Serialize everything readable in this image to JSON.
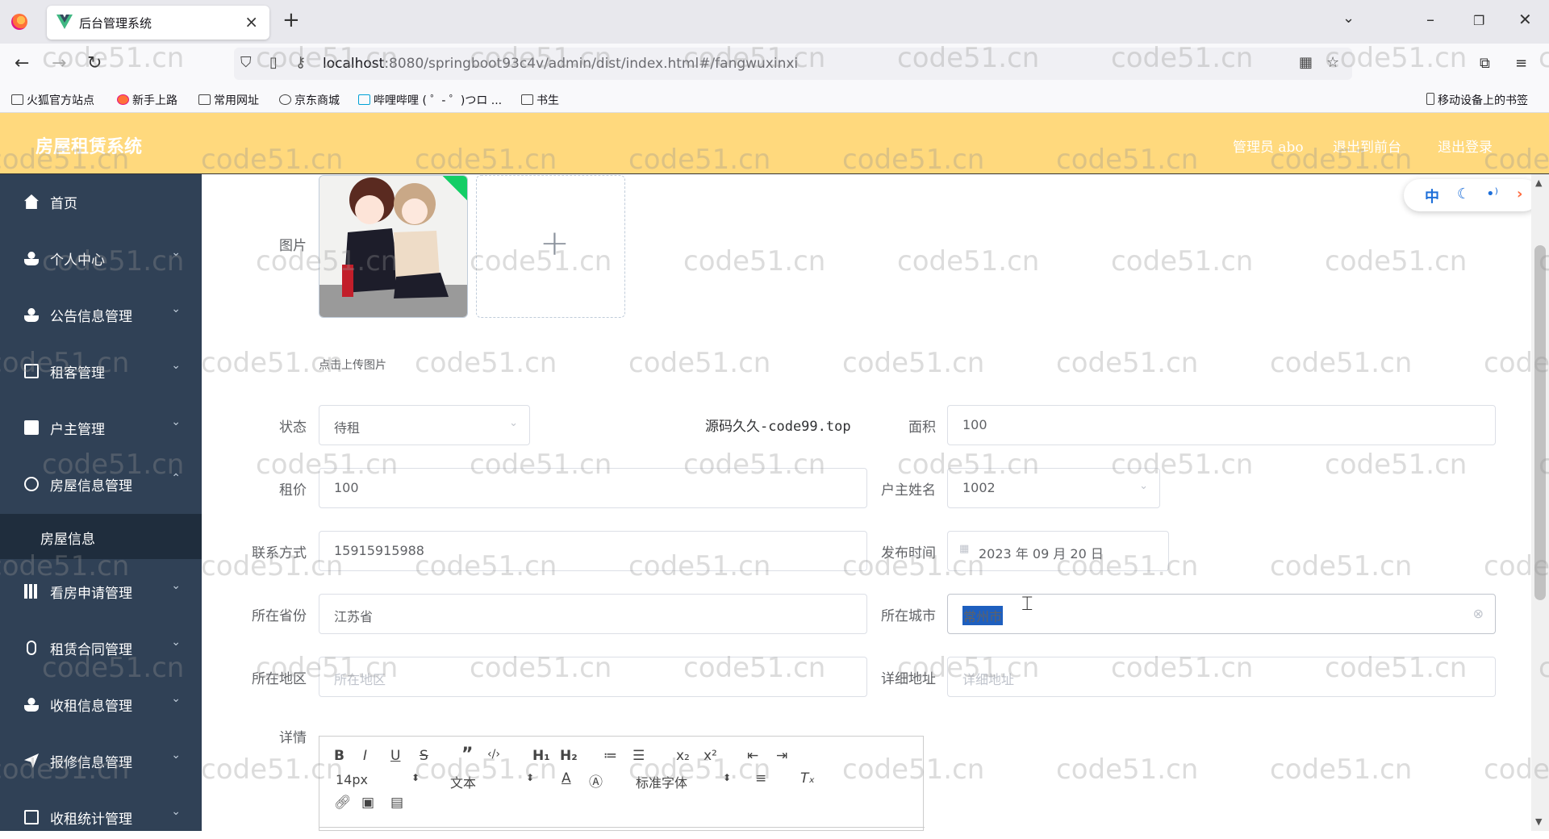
{
  "browser": {
    "tab_title": "后台管理系统",
    "url_host": "localhost",
    "url_rest": ":8080/springboot93c4v/admin/dist/index.html#/fangwuxinxi",
    "bookmarks": [
      "火狐官方站点",
      "新手上路",
      "常用网址",
      "京东商城",
      "哔哩哔哩 ( ゜- ゜)つロ ...",
      "书生"
    ],
    "mobile_bookmarks": "移动设备上的书签"
  },
  "header": {
    "app_title": "房屋租赁系统",
    "user_label": "管理员 abo",
    "front_label": "退出到前台",
    "logout_label": "退出登录"
  },
  "sidebar": {
    "items": [
      {
        "label": "首页"
      },
      {
        "label": "个人中心"
      },
      {
        "label": "公告信息管理"
      },
      {
        "label": "租客管理"
      },
      {
        "label": "户主管理"
      },
      {
        "label": "房屋信息管理"
      },
      {
        "label": "看房申请管理"
      },
      {
        "label": "租赁合同管理"
      },
      {
        "label": "收租信息管理"
      },
      {
        "label": "报修信息管理"
      },
      {
        "label": "收租统计管理"
      }
    ],
    "sub_item": "房屋信息"
  },
  "form": {
    "image_label": "图片",
    "upload_hint": "点击上传图片",
    "status_label": "状态",
    "status_value": "待租",
    "area_label": "面积",
    "area_value": "100",
    "rent_label": "租价",
    "rent_value": "100",
    "owner_label": "户主姓名",
    "owner_value": "1002",
    "contact_label": "联系方式",
    "contact_value": "15915915988",
    "publish_label": "发布时间",
    "publish_value": "2023 年 09 月 20 日",
    "province_label": "所在省份",
    "province_value": "江苏省",
    "city_label": "所在城市",
    "city_value": "常州市",
    "district_label": "所在地区",
    "district_placeholder": "所在地区",
    "address_label": "详细地址",
    "address_placeholder": "详细地址",
    "detail_label": "详情"
  },
  "editor": {
    "font_size": "14px",
    "paragraph": "文本",
    "font_family": "标准字体"
  },
  "site_label": "源码久久-code99.top",
  "lang_pill": [
    "中"
  ],
  "watermark": "code51.cn"
}
